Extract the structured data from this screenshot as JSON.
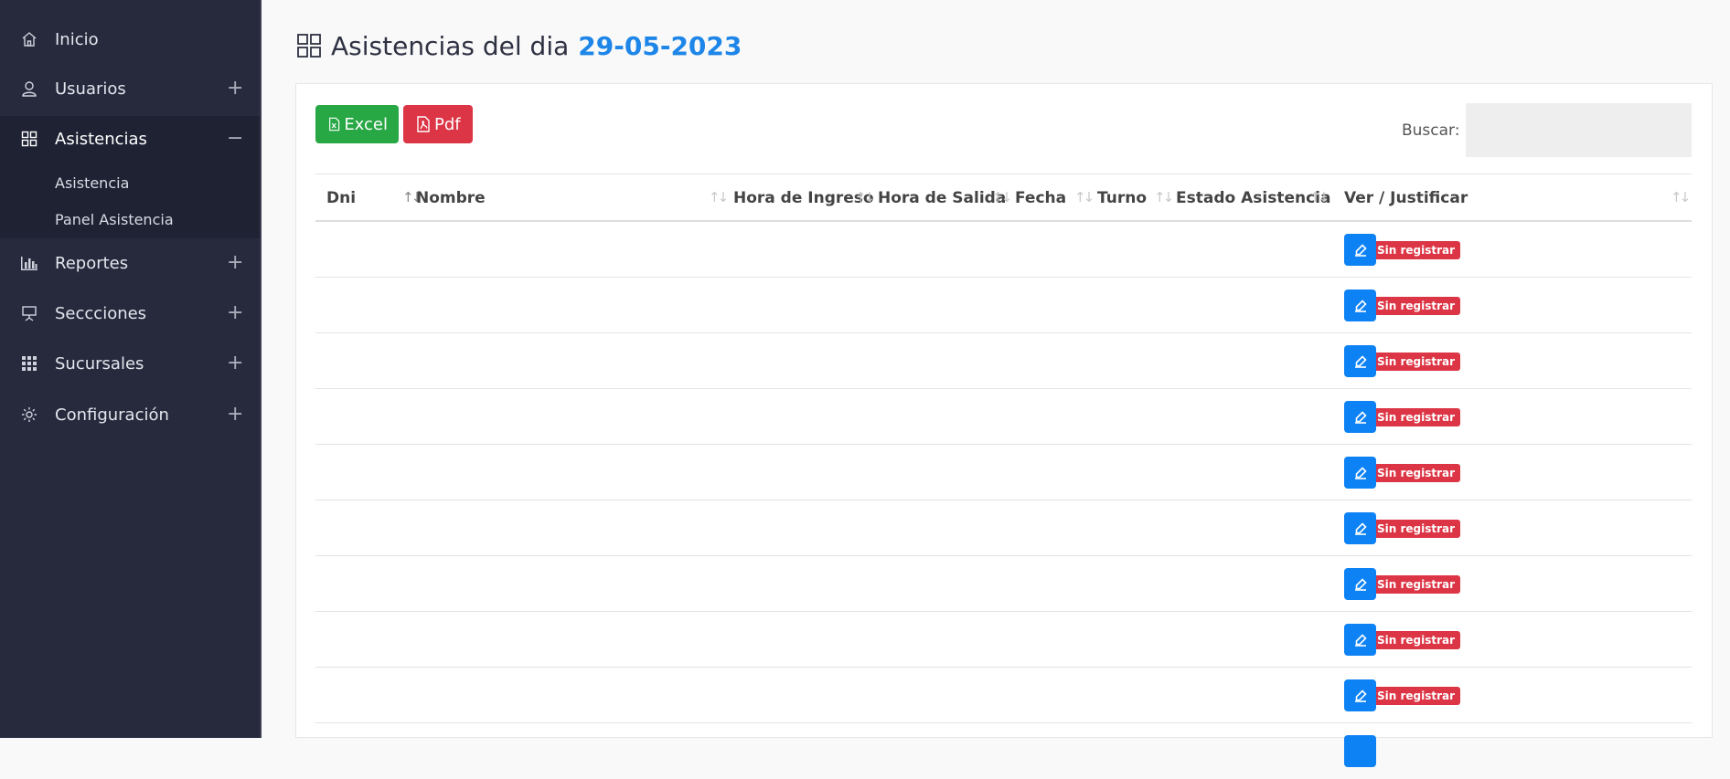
{
  "sidebar": {
    "items": [
      {
        "label": "Inicio",
        "icon": "home-icon"
      },
      {
        "label": "Usuarios",
        "icon": "user-icon",
        "toggle": "+"
      },
      {
        "label": "Asistencias",
        "icon": "grid-icon",
        "toggle": "−"
      },
      {
        "label": "Reportes",
        "icon": "bar-chart-icon",
        "toggle": "+"
      },
      {
        "label": "Seccciones",
        "icon": "presentation-icon",
        "toggle": "+"
      },
      {
        "label": "Sucursales",
        "icon": "building-grid-icon",
        "toggle": "+"
      },
      {
        "label": "Configuración",
        "icon": "gear-icon",
        "toggle": "+"
      }
    ],
    "submenu": [
      "Asistencia",
      "Panel Asistencia"
    ]
  },
  "page": {
    "title": "Asistencias del dia",
    "date": "29-05-2023"
  },
  "toolbar": {
    "excel_label": "Excel",
    "pdf_label": "Pdf",
    "search_label": "Buscar:",
    "search_value": ""
  },
  "table": {
    "columns": [
      "Dni",
      "Nombre",
      "Hora de Ingreso",
      "Hora de Salida",
      "Fecha",
      "Turno",
      "Estado Asistencia",
      "Ver / Justificar"
    ],
    "rows": [
      {
        "status": "Sin registrar"
      },
      {
        "status": "Sin registrar"
      },
      {
        "status": "Sin registrar"
      },
      {
        "status": "Sin registrar"
      },
      {
        "status": "Sin registrar"
      },
      {
        "status": "Sin registrar"
      },
      {
        "status": "Sin registrar"
      },
      {
        "status": "Sin registrar"
      },
      {
        "status": "Sin registrar"
      }
    ]
  },
  "colors": {
    "sidebar_bg": "#272a3d",
    "accent_blue": "#1e86e8",
    "excel_green": "#28a745",
    "danger_red": "#dc3545"
  }
}
